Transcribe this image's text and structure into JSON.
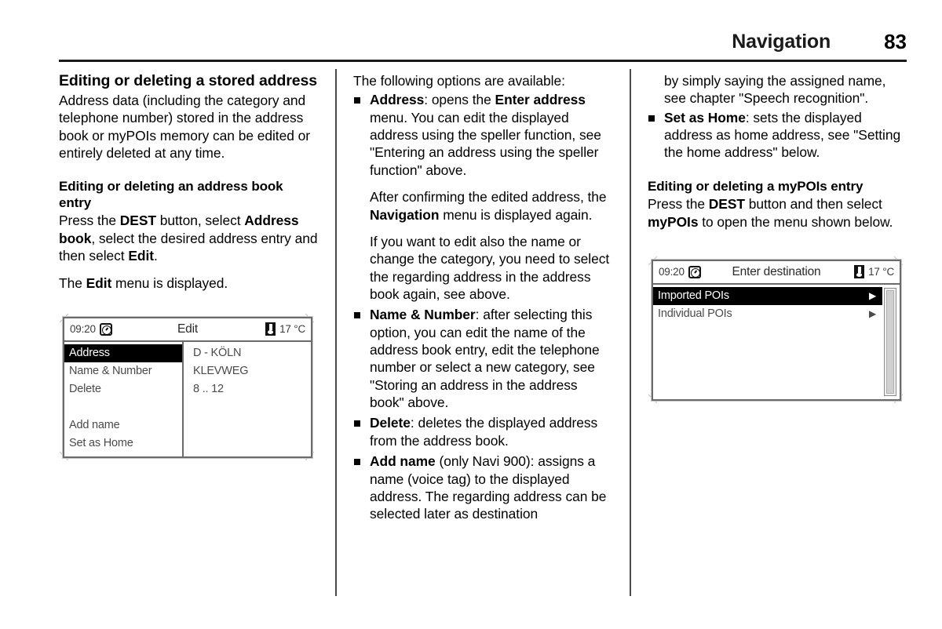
{
  "header": {
    "chapter": "Navigation",
    "page_number": "83"
  },
  "column1": {
    "heading": "Editing or deleting a stored address",
    "intro": "Address data (including the category and telephone number) stored in the address book or myPOIs memory can be edited or entirely deleted at any time.",
    "subheading": "Editing or deleting an address book entry",
    "para1_a": "Press the ",
    "para1_b": "DEST",
    "para1_c": " button, select ",
    "para1_d": "Address book",
    "para1_e": ", select the desired address entry and then select ",
    "para1_f": "Edit",
    "para1_g": ".",
    "para2_a": "The ",
    "para2_b": "Edit",
    "para2_c": " menu is displayed.",
    "screenshot": {
      "name": "edit-menu-screenshot",
      "clock": "09:20",
      "clock_icon": "clock-icon",
      "title": "Edit",
      "temperature": "17 °C",
      "temp_icon": "thermometer-icon",
      "menu_items": [
        {
          "label": "Address",
          "selected": true
        },
        {
          "label": "Name & Number",
          "selected": false
        },
        {
          "label": "Delete",
          "selected": false
        },
        {
          "label": "",
          "selected": false
        },
        {
          "label": "Add name",
          "selected": false
        },
        {
          "label": "Set as Home",
          "selected": false
        }
      ],
      "values": [
        "D - KÖLN",
        "KLEVWEG",
        "8 .. 12"
      ]
    }
  },
  "column2": {
    "lead": "The following options are available:",
    "bullets": [
      {
        "term": "Address",
        "rest": ": opens the ",
        "term2": "Enter address",
        "rest2": " menu. You can edit the displayed address using the speller function, see \"Entering an address using the speller function\" above.",
        "extra": [
          {
            "a": "After confirming the edited address, the ",
            "b": "Navigation",
            "c": " menu is displayed again."
          },
          {
            "a": "If you want to edit also the name or change the category, you need to select the regarding address in the address book again, see above.",
            "b": "",
            "c": ""
          }
        ]
      },
      {
        "term": "Name & Number",
        "rest": ": after selecting this option, you can edit the name of the address book entry, edit the telephone number or select a new category, see \"Storing an address in the address book\" above.",
        "term2": "",
        "rest2": "",
        "extra": []
      },
      {
        "term": "Delete",
        "rest": ": deletes the displayed address from the address book.",
        "term2": "",
        "rest2": "",
        "extra": []
      },
      {
        "term": "Add name",
        "rest": " (only Navi 900): assigns a name (voice tag) to the displayed address. The regarding address can be selected later as destination",
        "term2": "",
        "rest2": "",
        "extra": []
      }
    ]
  },
  "column3": {
    "continuation": "by simply saying the assigned name, see chapter \"Speech recognition\".",
    "bullet": {
      "term": "Set as Home",
      "rest": ": sets the displayed address as home address, see \"Setting the home address\" below."
    },
    "subheading": "Editing or deleting a myPOIs entry",
    "para_a": "Press the ",
    "para_b": "DEST",
    "para_c": " button and then select ",
    "para_d": "myPOIs",
    "para_e": " to open the menu shown below.",
    "screenshot": {
      "name": "enter-destination-screenshot",
      "clock": "09:20",
      "clock_icon": "clock-icon",
      "title": "Enter destination",
      "temperature": "17 °C",
      "temp_icon": "thermometer-icon",
      "list_items": [
        {
          "label": "Imported POIs",
          "selected": true,
          "arrow": "▶"
        },
        {
          "label": "Individual POIs",
          "selected": false,
          "arrow": "▶"
        }
      ],
      "scrollbar": "vertical-scrollbar"
    }
  }
}
